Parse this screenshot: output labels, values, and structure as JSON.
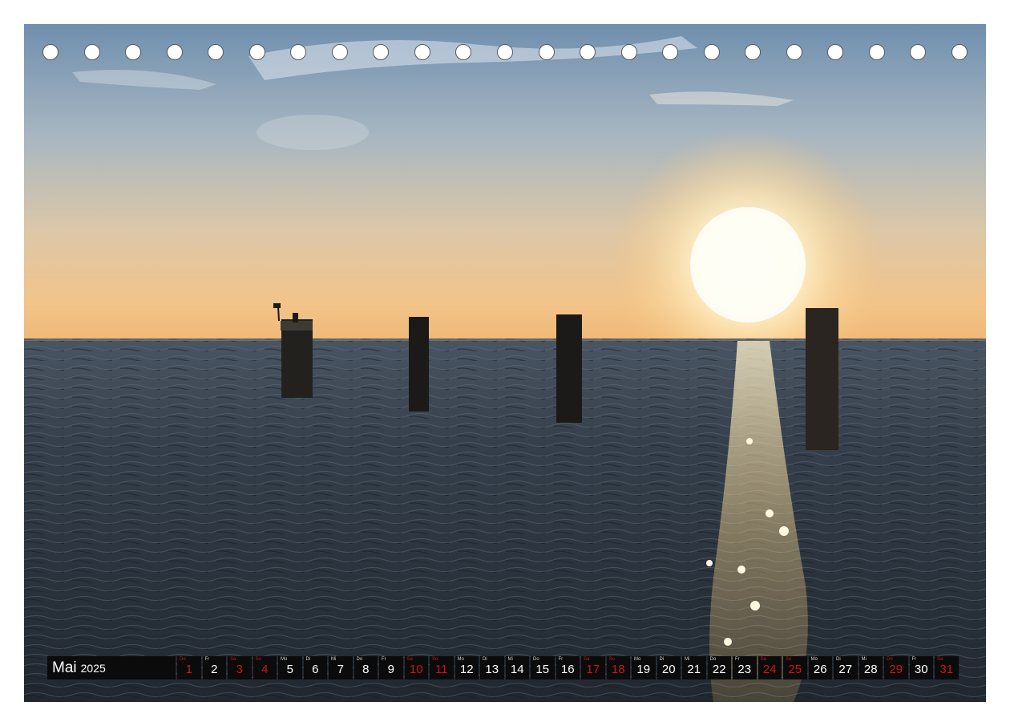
{
  "calendar": {
    "month": "Mai",
    "year": "2025",
    "days": [
      {
        "wd": "Do",
        "num": "1",
        "red": true
      },
      {
        "wd": "Fr",
        "num": "2",
        "red": false
      },
      {
        "wd": "Sa",
        "num": "3",
        "red": true
      },
      {
        "wd": "So",
        "num": "4",
        "red": true
      },
      {
        "wd": "Mo",
        "num": "5",
        "red": false
      },
      {
        "wd": "Di",
        "num": "6",
        "red": false
      },
      {
        "wd": "Mi",
        "num": "7",
        "red": false
      },
      {
        "wd": "Do",
        "num": "8",
        "red": false
      },
      {
        "wd": "Fr",
        "num": "9",
        "red": false
      },
      {
        "wd": "Sa",
        "num": "10",
        "red": true
      },
      {
        "wd": "So",
        "num": "11",
        "red": true
      },
      {
        "wd": "Mo",
        "num": "12",
        "red": false
      },
      {
        "wd": "Di",
        "num": "13",
        "red": false
      },
      {
        "wd": "Mi",
        "num": "14",
        "red": false
      },
      {
        "wd": "Do",
        "num": "15",
        "red": false
      },
      {
        "wd": "Fr",
        "num": "16",
        "red": false
      },
      {
        "wd": "Sa",
        "num": "17",
        "red": true
      },
      {
        "wd": "So",
        "num": "18",
        "red": true
      },
      {
        "wd": "Mo",
        "num": "19",
        "red": false
      },
      {
        "wd": "Di",
        "num": "20",
        "red": false
      },
      {
        "wd": "Mi",
        "num": "21",
        "red": false
      },
      {
        "wd": "Do",
        "num": "22",
        "red": false
      },
      {
        "wd": "Fr",
        "num": "23",
        "red": false
      },
      {
        "wd": "Sa",
        "num": "24",
        "red": true
      },
      {
        "wd": "So",
        "num": "25",
        "red": true
      },
      {
        "wd": "Mo",
        "num": "26",
        "red": false
      },
      {
        "wd": "Di",
        "num": "27",
        "red": false
      },
      {
        "wd": "Mi",
        "num": "28",
        "red": false
      },
      {
        "wd": "Do",
        "num": "29",
        "red": true
      },
      {
        "wd": "Fr",
        "num": "30",
        "red": false
      },
      {
        "wd": "Sa",
        "num": "31",
        "red": true
      }
    ]
  },
  "colors": {
    "holiday_red": "#d0131b",
    "bar_black": "#0b0b0b",
    "sky_top": "#6f8fae",
    "sky_horizon": "#f2c48a",
    "sea": "#2c3540"
  }
}
